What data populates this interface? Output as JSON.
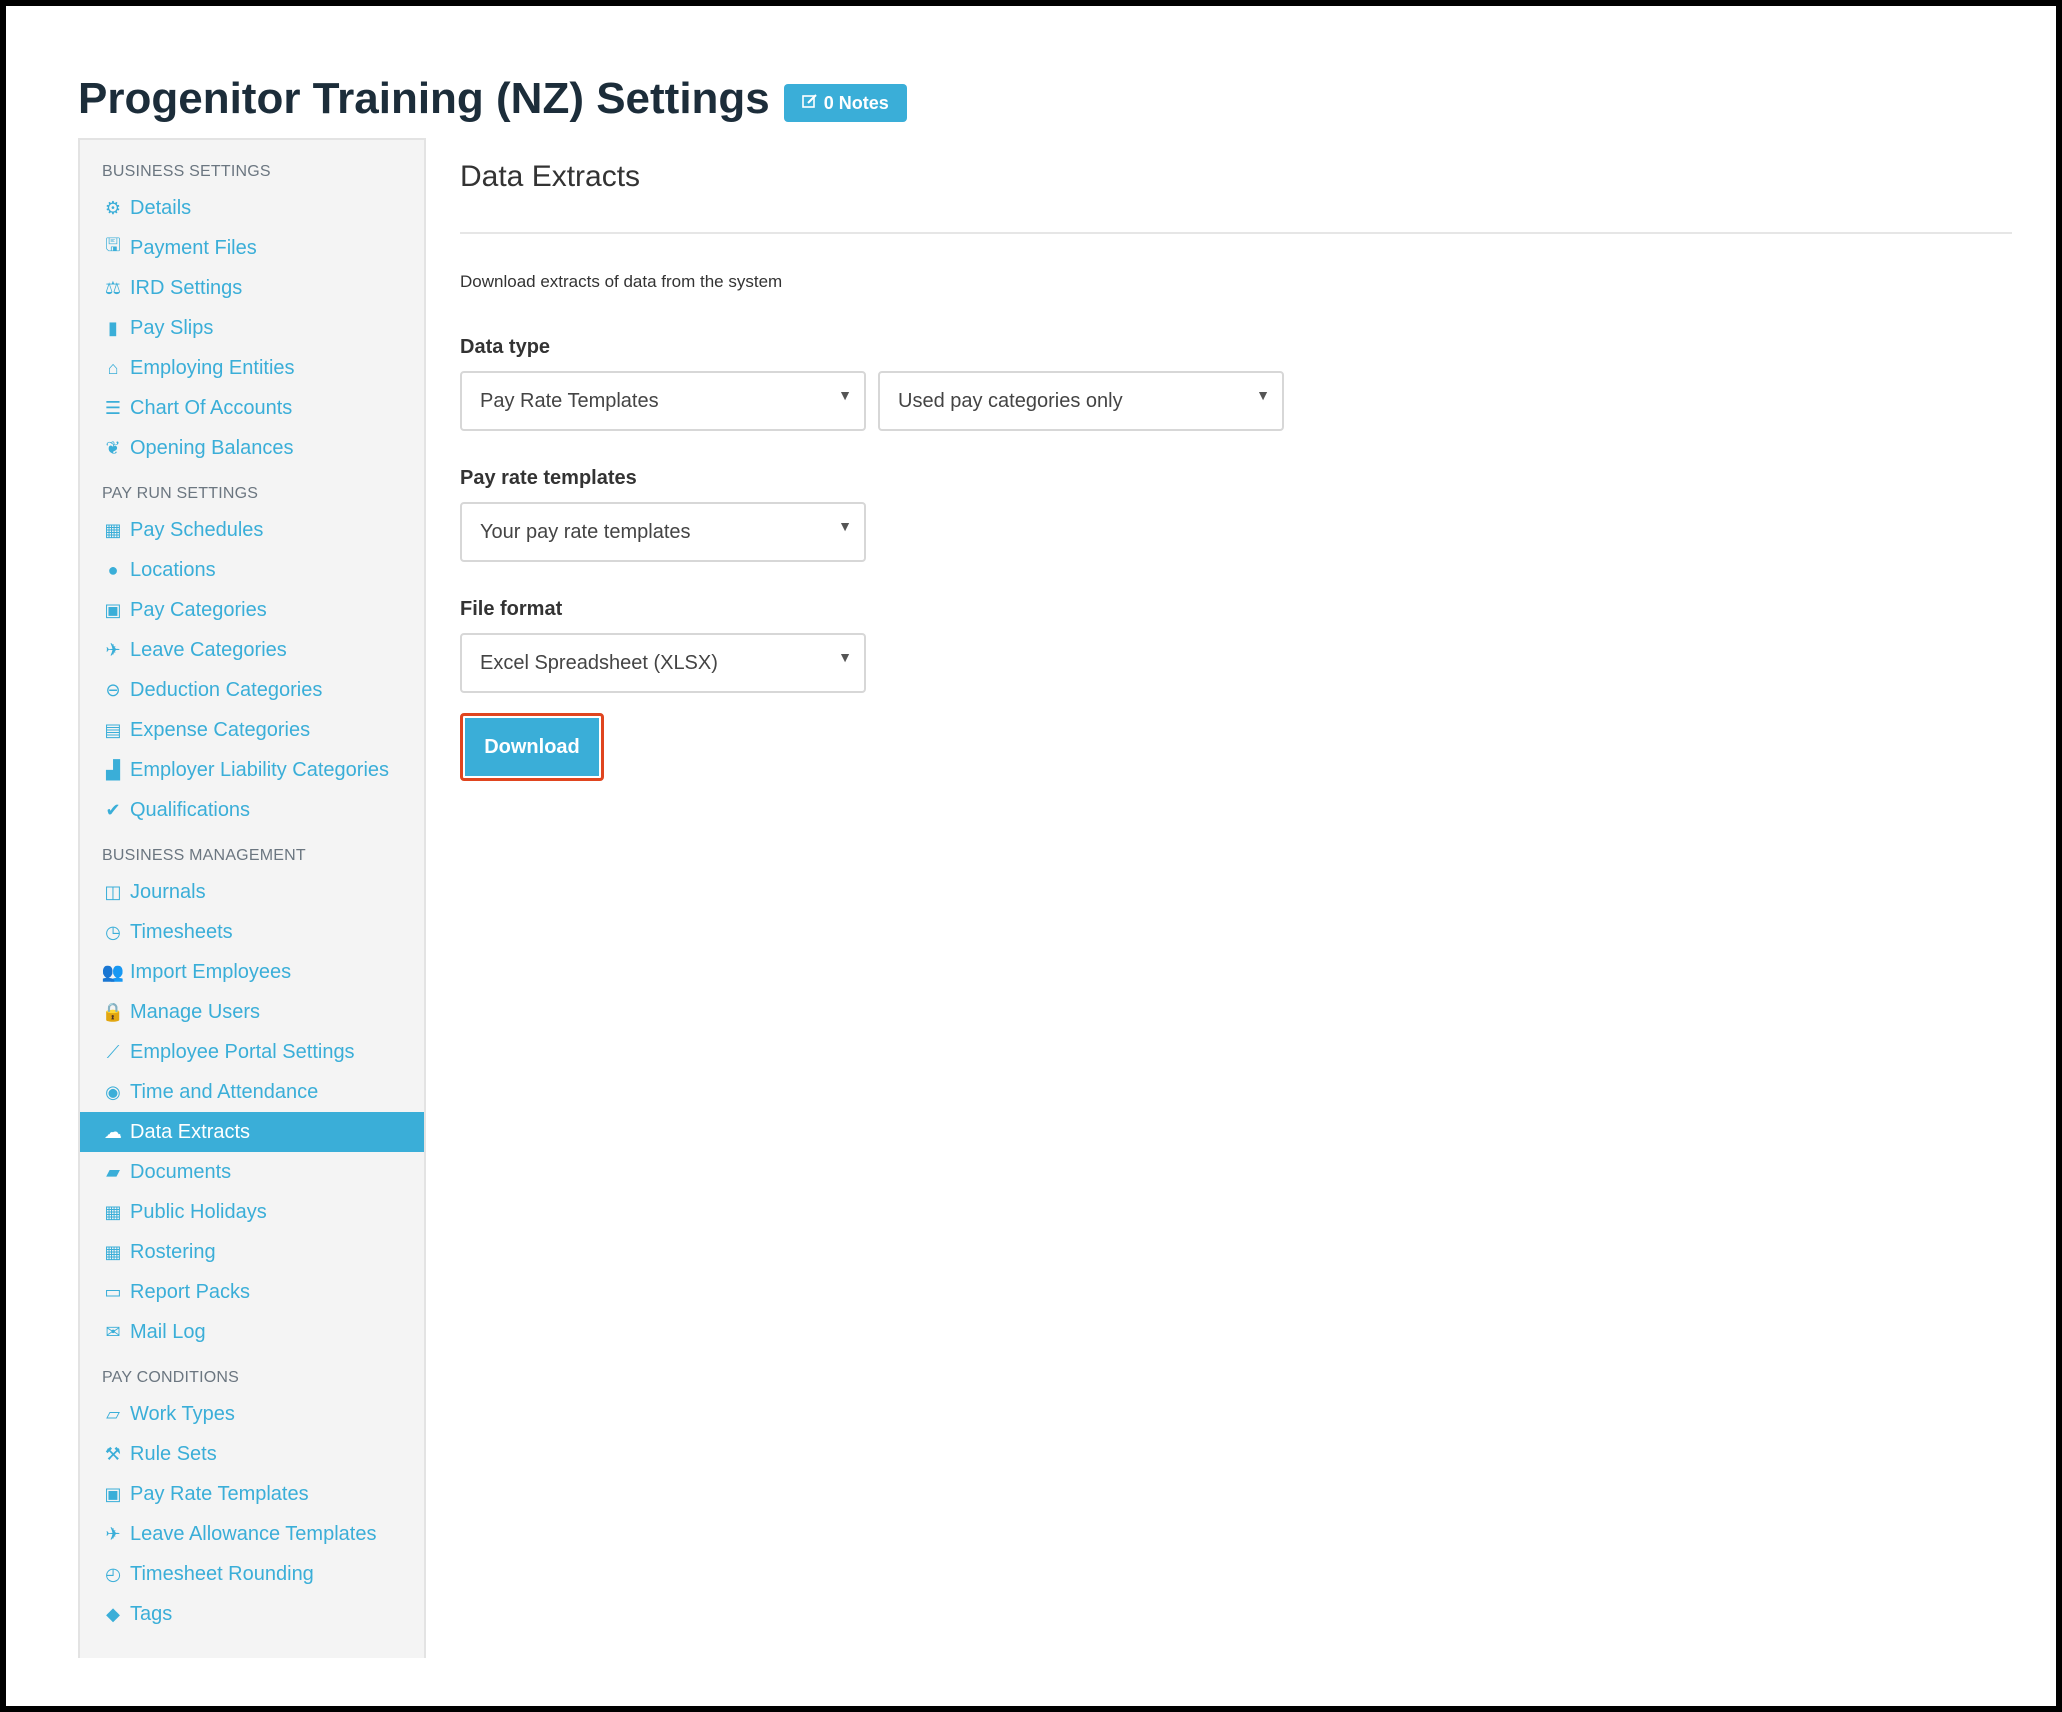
{
  "header": {
    "title": "Progenitor Training (NZ) Settings",
    "notes_label": "0 Notes"
  },
  "sidebar": {
    "sections": [
      {
        "label": "BUSINESS SETTINGS",
        "items": [
          {
            "label": "Details",
            "icon": "gear-icon"
          },
          {
            "label": "Payment Files",
            "icon": "save-icon"
          },
          {
            "label": "IRD Settings",
            "icon": "scale-icon"
          },
          {
            "label": "Pay Slips",
            "icon": "file-icon"
          },
          {
            "label": "Employing Entities",
            "icon": "bank-icon"
          },
          {
            "label": "Chart Of Accounts",
            "icon": "list-icon"
          },
          {
            "label": "Opening Balances",
            "icon": "leaf-icon"
          }
        ]
      },
      {
        "label": "PAY RUN SETTINGS",
        "items": [
          {
            "label": "Pay Schedules",
            "icon": "calendar-icon"
          },
          {
            "label": "Locations",
            "icon": "globe-icon"
          },
          {
            "label": "Pay Categories",
            "icon": "money-icon"
          },
          {
            "label": "Leave Categories",
            "icon": "plane-icon"
          },
          {
            "label": "Deduction Categories",
            "icon": "minus-circle-icon"
          },
          {
            "label": "Expense Categories",
            "icon": "archive-icon"
          },
          {
            "label": "Employer Liability Categories",
            "icon": "industry-icon"
          },
          {
            "label": "Qualifications",
            "icon": "check-icon"
          }
        ]
      },
      {
        "label": "BUSINESS MANAGEMENT",
        "items": [
          {
            "label": "Journals",
            "icon": "columns-icon"
          },
          {
            "label": "Timesheets",
            "icon": "clock-icon"
          },
          {
            "label": "Import Employees",
            "icon": "users-icon"
          },
          {
            "label": "Manage Users",
            "icon": "lock-icon"
          },
          {
            "label": "Employee Portal Settings",
            "icon": "magic-wand-icon"
          },
          {
            "label": "Time and Attendance",
            "icon": "user-circle-icon"
          },
          {
            "label": "Data Extracts",
            "icon": "cloud-download-icon",
            "active": true
          },
          {
            "label": "Documents",
            "icon": "folder-icon"
          },
          {
            "label": "Public Holidays",
            "icon": "calendar-icon"
          },
          {
            "label": "Rostering",
            "icon": "calendar-grid-icon"
          },
          {
            "label": "Report Packs",
            "icon": "folder-open-icon"
          },
          {
            "label": "Mail Log",
            "icon": "envelope-icon"
          }
        ]
      },
      {
        "label": "PAY CONDITIONS",
        "items": [
          {
            "label": "Work Types",
            "icon": "book-icon"
          },
          {
            "label": "Rule Sets",
            "icon": "gavel-icon"
          },
          {
            "label": "Pay Rate Templates",
            "icon": "money-icon"
          },
          {
            "label": "Leave Allowance Templates",
            "icon": "plane-icon"
          },
          {
            "label": "Timesheet Rounding",
            "icon": "clock-o-icon"
          },
          {
            "label": "Tags",
            "icon": "tag-icon"
          }
        ]
      }
    ]
  },
  "main": {
    "title": "Data Extracts",
    "description": "Download extracts of data from the system",
    "data_type": {
      "label": "Data type",
      "selected": "Pay Rate Templates",
      "filter_selected": "Used pay categories only"
    },
    "pay_rate_templates": {
      "label": "Pay rate templates",
      "selected": "Your pay rate templates"
    },
    "file_format": {
      "label": "File format",
      "selected": "Excel Spreadsheet (XLSX)"
    },
    "download_label": "Download"
  },
  "colors": {
    "accent": "#3aaed8",
    "highlight_border": "#e0451f"
  }
}
